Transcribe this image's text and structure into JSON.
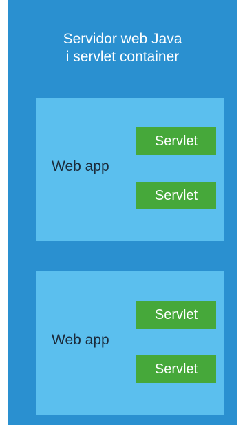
{
  "container": {
    "title_lines": [
      "Servidor web Java",
      "i servlet container"
    ]
  },
  "webapps": [
    {
      "label": "Web app",
      "servlets": [
        "Servlet",
        "Servlet"
      ]
    },
    {
      "label": "Web app",
      "servlets": [
        "Servlet",
        "Servlet"
      ]
    }
  ],
  "colors": {
    "container": "#2a90d0",
    "webapp": "#5bbfee",
    "servlet": "#46a83a",
    "title_text": "#ffffff",
    "webapp_text": "#1b2a3a"
  }
}
